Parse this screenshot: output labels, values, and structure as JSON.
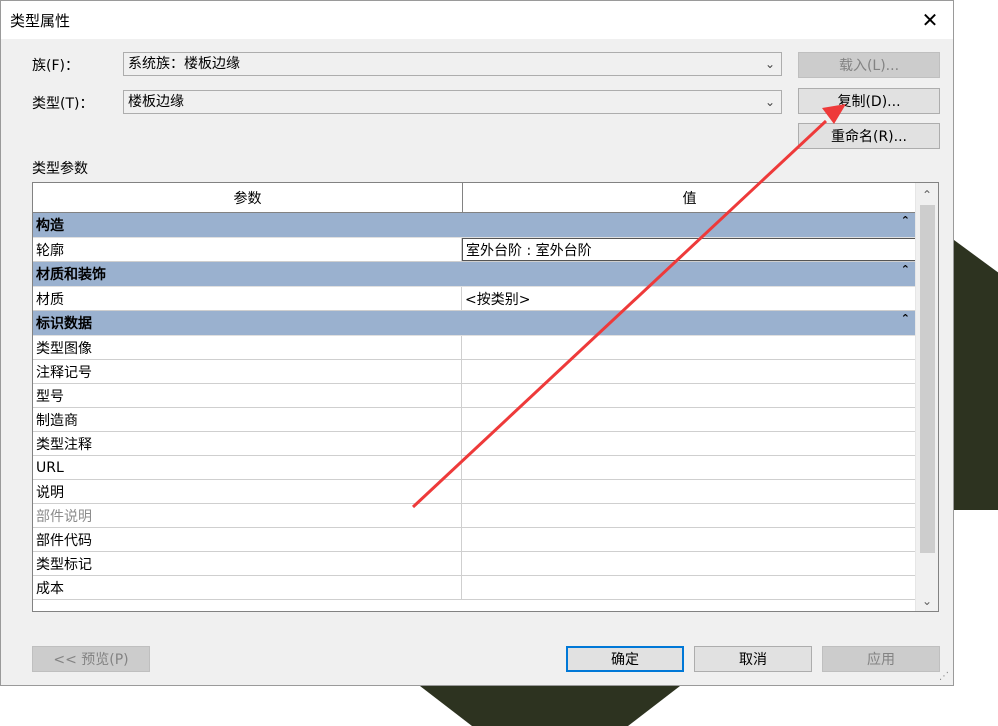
{
  "dialog": {
    "title": "类型属性",
    "close_glyph": "✕"
  },
  "family": {
    "label": "族(F)：",
    "value": "系统族：楼板边缘"
  },
  "type": {
    "label": "类型(T)：",
    "value": "楼板边缘"
  },
  "buttons": {
    "load": "载入(L)...",
    "duplicate": "复制(D)...",
    "rename": "重命名(R)...",
    "preview": "<< 预览(P)",
    "ok": "确定",
    "cancel": "取消",
    "apply": "应用"
  },
  "section_label": "类型参数",
  "grid": {
    "header": {
      "param": "参数",
      "value": "值"
    },
    "groups": [
      {
        "name": "构造",
        "rows": [
          {
            "param": "轮廓",
            "value": "室外台阶 : 室外台阶",
            "editing": true
          }
        ]
      },
      {
        "name": "材质和装饰",
        "rows": [
          {
            "param": "材质",
            "value": "<按类别>"
          }
        ]
      },
      {
        "name": "标识数据",
        "rows": [
          {
            "param": "类型图像",
            "value": ""
          },
          {
            "param": "注释记号",
            "value": ""
          },
          {
            "param": "型号",
            "value": ""
          },
          {
            "param": "制造商",
            "value": ""
          },
          {
            "param": "类型注释",
            "value": ""
          },
          {
            "param": "URL",
            "value": ""
          },
          {
            "param": "说明",
            "value": ""
          },
          {
            "param": "部件说明",
            "value": "",
            "grey": true
          },
          {
            "param": "部件代码",
            "value": ""
          },
          {
            "param": "类型标记",
            "value": ""
          },
          {
            "param": "成本",
            "value": ""
          }
        ]
      }
    ]
  },
  "icons": {
    "collapse": "double-chevron-up-icon",
    "dropdown": "chevron-down-icon"
  },
  "colors": {
    "group_header": "#9ab1cf",
    "annotation_arrow": "#ee3a3a",
    "focus": "#0078d7"
  }
}
